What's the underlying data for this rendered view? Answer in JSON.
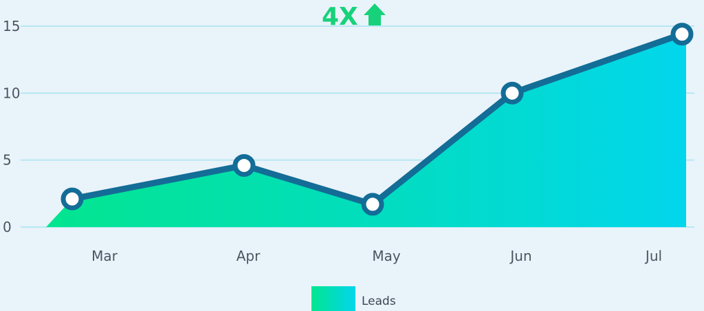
{
  "headline": {
    "text": "4X",
    "icon": "arrow-up-icon",
    "color": "#17d27a"
  },
  "chart_data": {
    "type": "area",
    "categories": [
      "Mar",
      "Apr",
      "May",
      "Jun",
      "Jul"
    ],
    "series": [
      {
        "name": "Leads",
        "values": [
          2.1,
          4.6,
          1.7,
          10.0,
          14.4
        ]
      }
    ],
    "y_ticks": [
      "0",
      "5",
      "10",
      "15"
    ],
    "ylim": [
      0,
      15
    ],
    "grid": true,
    "legend": "bottom-center",
    "colors": {
      "line": "#136d96",
      "fill_start": "#03e58f",
      "fill_end": "#02d6ec",
      "grid": "#a6e4f0",
      "marker_fill": "#ffffff"
    }
  }
}
